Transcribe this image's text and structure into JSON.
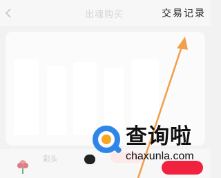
{
  "topbar": {
    "back_icon": "chevron-left-icon",
    "title": "出魂购买",
    "trade_records_label": "交易记录"
  },
  "list_row": {
    "icon": "flower-icon",
    "text": "彩头"
  },
  "watermark": {
    "logo_icon": "chaxunla-logo-icon",
    "name": "查询啦",
    "domain": "chaxunla.com"
  },
  "colors": {
    "accent": "#f0223f",
    "arrow": "#f2a04c",
    "logo_blue": "#2f86e8",
    "logo_orange": "#f5a623"
  }
}
